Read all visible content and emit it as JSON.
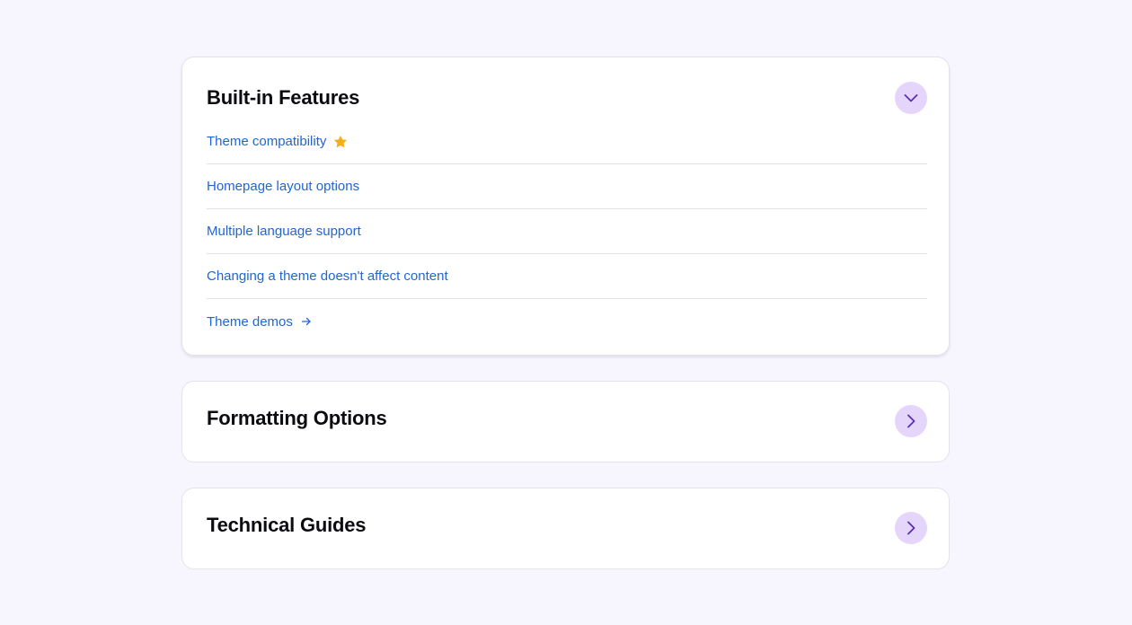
{
  "sections": [
    {
      "title": "Built-in Features",
      "expanded": true,
      "toggle_icon": "chevron-down-icon",
      "items": [
        {
          "label": "Theme compatibility",
          "icon": "star-icon"
        },
        {
          "label": "Homepage layout options"
        },
        {
          "label": "Multiple language support"
        },
        {
          "label": "Changing a theme doesn't affect content"
        },
        {
          "label": "Theme demos",
          "icon": "arrow-right-icon"
        }
      ]
    },
    {
      "title": "Formatting Options",
      "expanded": false,
      "toggle_icon": "chevron-right-icon"
    },
    {
      "title": "Technical Guides",
      "expanded": false,
      "toggle_icon": "chevron-right-icon"
    }
  ],
  "colors": {
    "page_background": "#f7f5fd",
    "link": "#2267cf",
    "toggle_background": "#e6d5fb",
    "toggle_icon": "#5b2fb0",
    "star": "#f6ae1b",
    "title": "#0b0b12"
  }
}
